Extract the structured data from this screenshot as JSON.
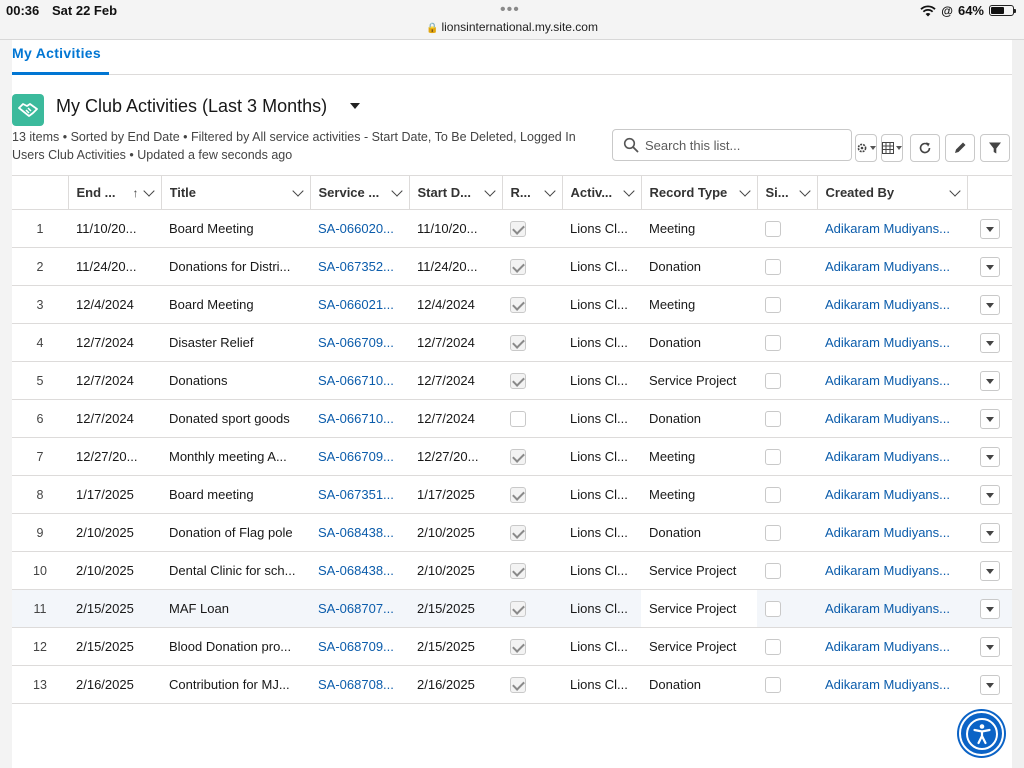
{
  "status_bar": {
    "time": "00:36",
    "date": "Sat 22 Feb",
    "url": "lionsinternational.my.site.com",
    "battery": "64%",
    "battery_level": 0.64
  },
  "tabs": [
    {
      "label": "My Activities",
      "active": true
    }
  ],
  "list_view": {
    "title": "My Club Activities (Last 3 Months)",
    "meta_line1": "13 items • Sorted by End Date • Filtered by All service activities - Start Date, To Be Deleted, Logged In",
    "meta_line2": "Users Club Activities • Updated a few seconds ago",
    "search_placeholder": "Search this list..."
  },
  "colors": {
    "accent": "#0176d3",
    "link": "#0b5cab",
    "icon_bg": "#3bba9c",
    "a11y": "#0b63c6"
  },
  "table": {
    "columns": [
      "End ...",
      "Title",
      "Service ...",
      "Start D...",
      "R...",
      "Activ...",
      "Record Type",
      "Si...",
      "Created By"
    ],
    "rows": [
      {
        "num": "1",
        "end": "11/10/20...",
        "title": "Board Meeting",
        "service": "SA-066020...",
        "start": "11/10/20...",
        "r": true,
        "activity": "Lions Cl...",
        "record_type": "Meeting",
        "si": false,
        "created_by": "Adikaram Mudiyans..."
      },
      {
        "num": "2",
        "end": "11/24/20...",
        "title": "Donations for Distri...",
        "service": "SA-067352...",
        "start": "11/24/20...",
        "r": true,
        "activity": "Lions Cl...",
        "record_type": "Donation",
        "si": false,
        "created_by": "Adikaram Mudiyans..."
      },
      {
        "num": "3",
        "end": "12/4/2024",
        "title": "Board Meeting",
        "service": "SA-066021...",
        "start": "12/4/2024",
        "r": true,
        "activity": "Lions Cl...",
        "record_type": "Meeting",
        "si": false,
        "created_by": "Adikaram Mudiyans..."
      },
      {
        "num": "4",
        "end": "12/7/2024",
        "title": "Disaster Relief",
        "service": "SA-066709...",
        "start": "12/7/2024",
        "r": true,
        "activity": "Lions Cl...",
        "record_type": "Donation",
        "si": false,
        "created_by": "Adikaram Mudiyans..."
      },
      {
        "num": "5",
        "end": "12/7/2024",
        "title": "Donations",
        "service": "SA-066710...",
        "start": "12/7/2024",
        "r": true,
        "activity": "Lions Cl...",
        "record_type": "Service Project",
        "si": false,
        "created_by": "Adikaram Mudiyans..."
      },
      {
        "num": "6",
        "end": "12/7/2024",
        "title": "Donated sport goods",
        "service": "SA-066710...",
        "start": "12/7/2024",
        "r": false,
        "activity": "Lions Cl...",
        "record_type": "Donation",
        "si": false,
        "created_by": "Adikaram Mudiyans..."
      },
      {
        "num": "7",
        "end": "12/27/20...",
        "title": "Monthly meeting A...",
        "service": "SA-066709...",
        "start": "12/27/20...",
        "r": true,
        "activity": "Lions Cl...",
        "record_type": "Meeting",
        "si": false,
        "created_by": "Adikaram Mudiyans..."
      },
      {
        "num": "8",
        "end": "1/17/2025",
        "title": "Board meeting",
        "service": "SA-067351...",
        "start": "1/17/2025",
        "r": true,
        "activity": "Lions Cl...",
        "record_type": "Meeting",
        "si": false,
        "created_by": "Adikaram Mudiyans..."
      },
      {
        "num": "9",
        "end": "2/10/2025",
        "title": "Donation of Flag pole",
        "service": "SA-068438...",
        "start": "2/10/2025",
        "r": true,
        "activity": "Lions Cl...",
        "record_type": "Donation",
        "si": false,
        "created_by": "Adikaram Mudiyans..."
      },
      {
        "num": "10",
        "end": "2/10/2025",
        "title": "Dental Clinic for sch...",
        "service": "SA-068438...",
        "start": "2/10/2025",
        "r": true,
        "activity": "Lions Cl...",
        "record_type": "Service Project",
        "si": false,
        "created_by": "Adikaram Mudiyans..."
      },
      {
        "num": "11",
        "end": "2/15/2025",
        "title": "MAF Loan",
        "service": "SA-068707...",
        "start": "2/15/2025",
        "r": true,
        "activity": "Lions Cl...",
        "record_type": "Service Project",
        "si": false,
        "created_by": "Adikaram Mudiyans...",
        "highlighted": true
      },
      {
        "num": "12",
        "end": "2/15/2025",
        "title": "Blood Donation pro...",
        "service": "SA-068709...",
        "start": "2/15/2025",
        "r": true,
        "activity": "Lions Cl...",
        "record_type": "Service Project",
        "si": false,
        "created_by": "Adikaram Mudiyans..."
      },
      {
        "num": "13",
        "end": "2/16/2025",
        "title": "Contribution for MJ...",
        "service": "SA-068708...",
        "start": "2/16/2025",
        "r": true,
        "activity": "Lions Cl...",
        "record_type": "Donation",
        "si": false,
        "created_by": "Adikaram Mudiyans..."
      }
    ]
  }
}
